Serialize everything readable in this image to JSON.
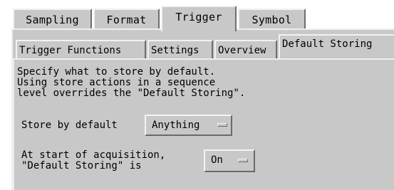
{
  "tabs": [
    {
      "label": "Sampling",
      "active": false
    },
    {
      "label": "Format",
      "active": false
    },
    {
      "label": "Trigger",
      "active": true
    },
    {
      "label": "Symbol",
      "active": false
    }
  ],
  "subtabs": [
    {
      "label": "Trigger Functions",
      "active": false
    },
    {
      "label": "Settings",
      "active": false
    },
    {
      "label": "Overview",
      "active": false
    },
    {
      "label": "Default Storing",
      "active": true
    }
  ],
  "description": "Specify what to store by default.\nUsing store actions in a sequence\nlevel overrides the \"Default Storing\".",
  "store_by_default": {
    "label": "Store by default",
    "value": "Anything"
  },
  "start_of_acquisition": {
    "label": "At start of acquisition,\n\"Default Storing\" is",
    "value": "On"
  },
  "colors": {
    "panel": "#c8c8c8",
    "highlight": "#f2f2f2",
    "shadow": "#6e6e6e"
  }
}
